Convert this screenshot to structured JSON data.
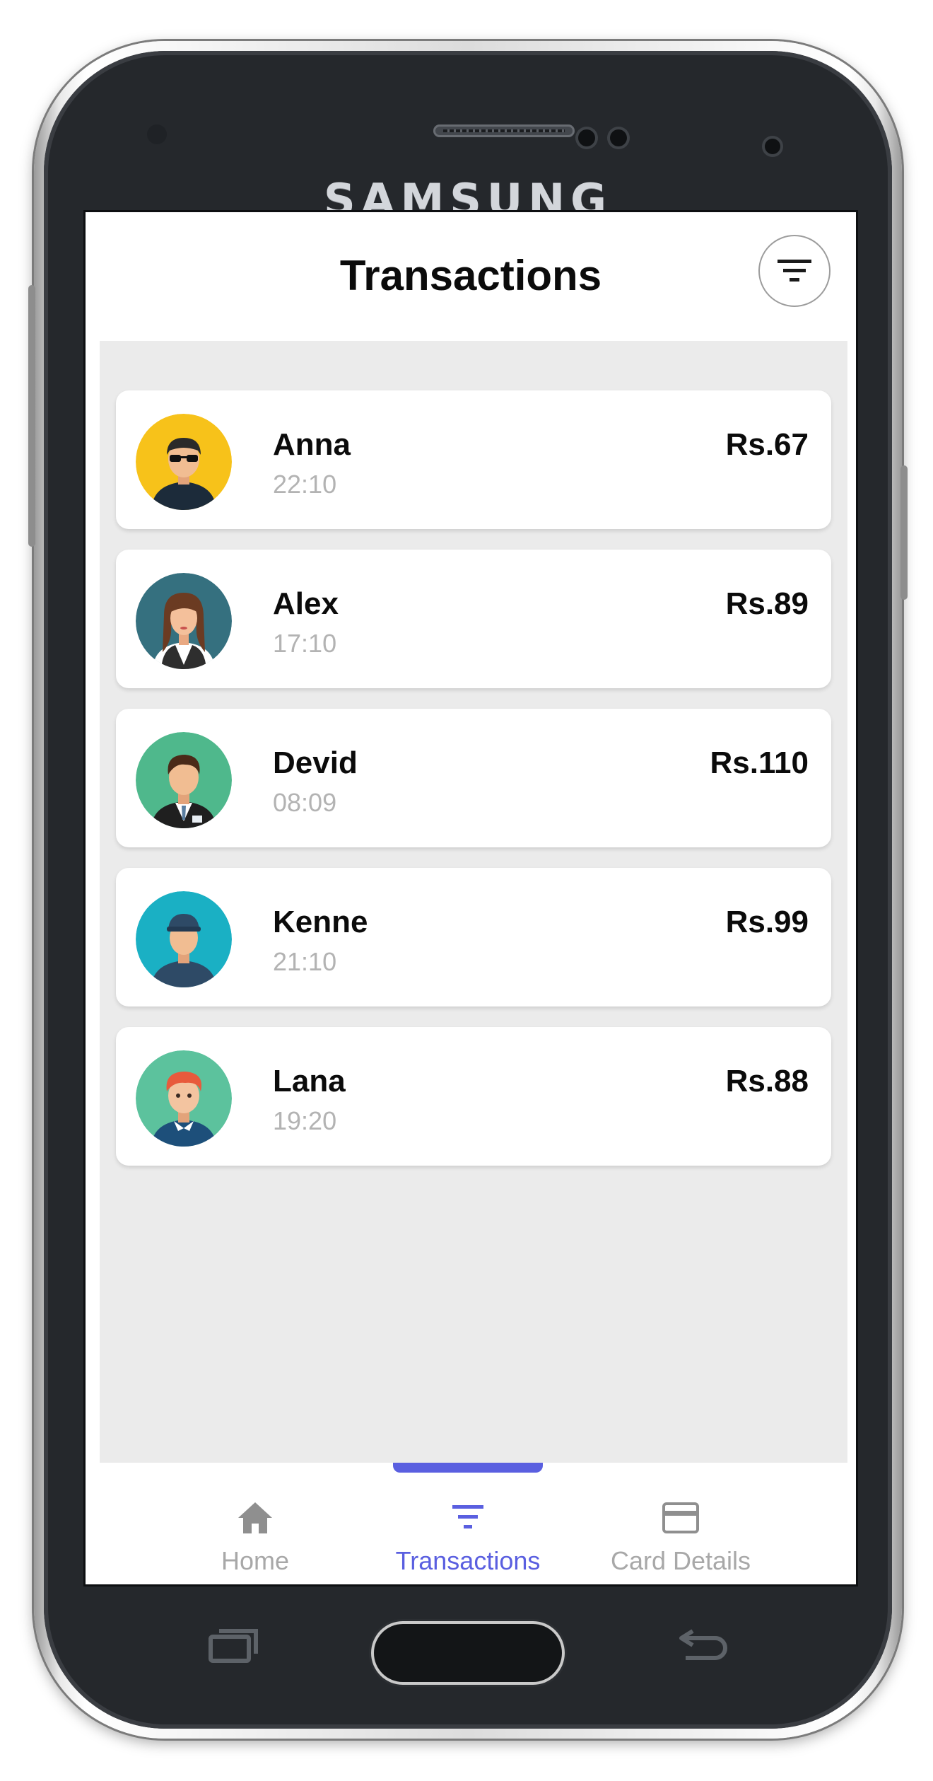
{
  "device": {
    "brand": "SAMSUNG"
  },
  "header": {
    "title": "Transactions",
    "filter_icon": "filter-icon"
  },
  "transactions": [
    {
      "name": "Anna",
      "time": "22:10",
      "amount": "Rs.67",
      "avatar": "avatar-sunglasses-man",
      "avatar_bg": "#f7c21a"
    },
    {
      "name": "Alex",
      "time": "17:10",
      "amount": "Rs.89",
      "avatar": "avatar-woman-vest",
      "avatar_bg": "#35707f"
    },
    {
      "name": "Devid",
      "time": "08:09",
      "amount": "Rs.110",
      "avatar": "avatar-businessman",
      "avatar_bg": "#4fb88c"
    },
    {
      "name": "Kenne",
      "time": "21:10",
      "amount": "Rs.99",
      "avatar": "avatar-cap-man",
      "avatar_bg": "#1ab0c4"
    },
    {
      "name": "Lana",
      "time": "19:20",
      "amount": "Rs.88",
      "avatar": "avatar-redhead-boy",
      "avatar_bg": "#5cc29d"
    }
  ],
  "nav": {
    "items": [
      {
        "label": "Home",
        "icon": "home-icon"
      },
      {
        "label": "Transactions",
        "icon": "filter-icon",
        "active": true
      },
      {
        "label": "Card Details",
        "icon": "card-icon"
      }
    ],
    "accent": "#5a5fe0"
  }
}
